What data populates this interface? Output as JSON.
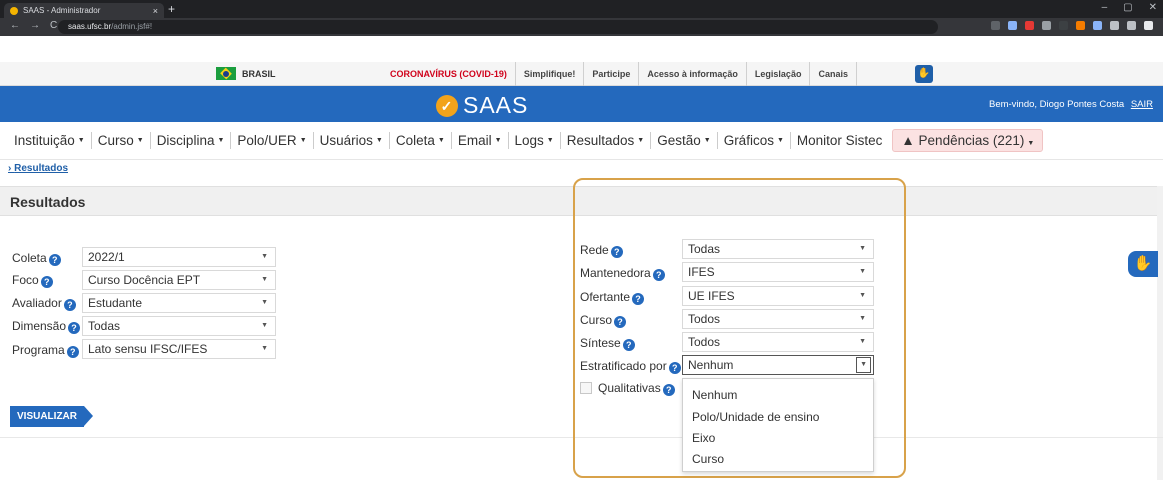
{
  "browser": {
    "tab_title": "SAAS - Administrador",
    "tab_close": "×",
    "new_tab": "+",
    "url_domain": "saas.ufsc.br",
    "url_path": "/admin.jsf#!",
    "nav": {
      "back": "←",
      "forward": "→",
      "reload": "C"
    },
    "window_controls": {
      "minimize": "–",
      "maximize": "▢",
      "close": "✕"
    }
  },
  "govbar": {
    "country": "BRASIL",
    "links": [
      "CORONAVÍRUS (COVID-19)",
      "Simplifique!",
      "Participe",
      "Acesso à informação",
      "Legislação",
      "Canais"
    ]
  },
  "header": {
    "logo_text": "SAAS",
    "welcome": "Bem-vindo, Diogo Pontes Costa",
    "logout": "SAIR"
  },
  "menu": {
    "items": [
      "Instituição",
      "Curso",
      "Disciplina",
      "Polo/UER",
      "Usuários",
      "Coleta",
      "Email",
      "Logs",
      "Resultados",
      "Gestão",
      "Gráficos",
      "Monitor Sistec"
    ],
    "pendencias": "Pendências (221)"
  },
  "breadcrumb": "Resultados",
  "section_title": "Resultados",
  "left_form": {
    "coleta": {
      "label": "Coleta",
      "value": "2022/1"
    },
    "foco": {
      "label": "Foco",
      "value": "Curso Docência EPT"
    },
    "avaliador": {
      "label": "Avaliador",
      "value": "Estudante"
    },
    "dimensao": {
      "label": "Dimensão",
      "value": "Todas"
    },
    "programa": {
      "label": "Programa",
      "value": "Lato sensu IFSC/IFES"
    }
  },
  "right_form": {
    "rede": {
      "label": "Rede",
      "value": "Todas"
    },
    "mantenedora": {
      "label": "Mantenedora",
      "value": "IFES"
    },
    "ofertante": {
      "label": "Ofertante",
      "value": "UE IFES"
    },
    "curso": {
      "label": "Curso",
      "value": "Todos"
    },
    "sintese": {
      "label": "Síntese",
      "value": "Todos"
    },
    "estratificado": {
      "label": "Estratificado por",
      "value": "Nenhum"
    },
    "qualitativas": {
      "label": "Qualitativas",
      "checked": false
    }
  },
  "dropdown_options": [
    "Nenhum",
    "Polo/Unidade de ensino",
    "Eixo",
    "Curso"
  ],
  "visualizar_button": "VISUALIZAR",
  "help_glyph": "?",
  "caret": "▼",
  "colors": {
    "brand_blue": "#2469bd",
    "highlight": "#d8a24a",
    "alert_bg": "#fbe2e2"
  }
}
